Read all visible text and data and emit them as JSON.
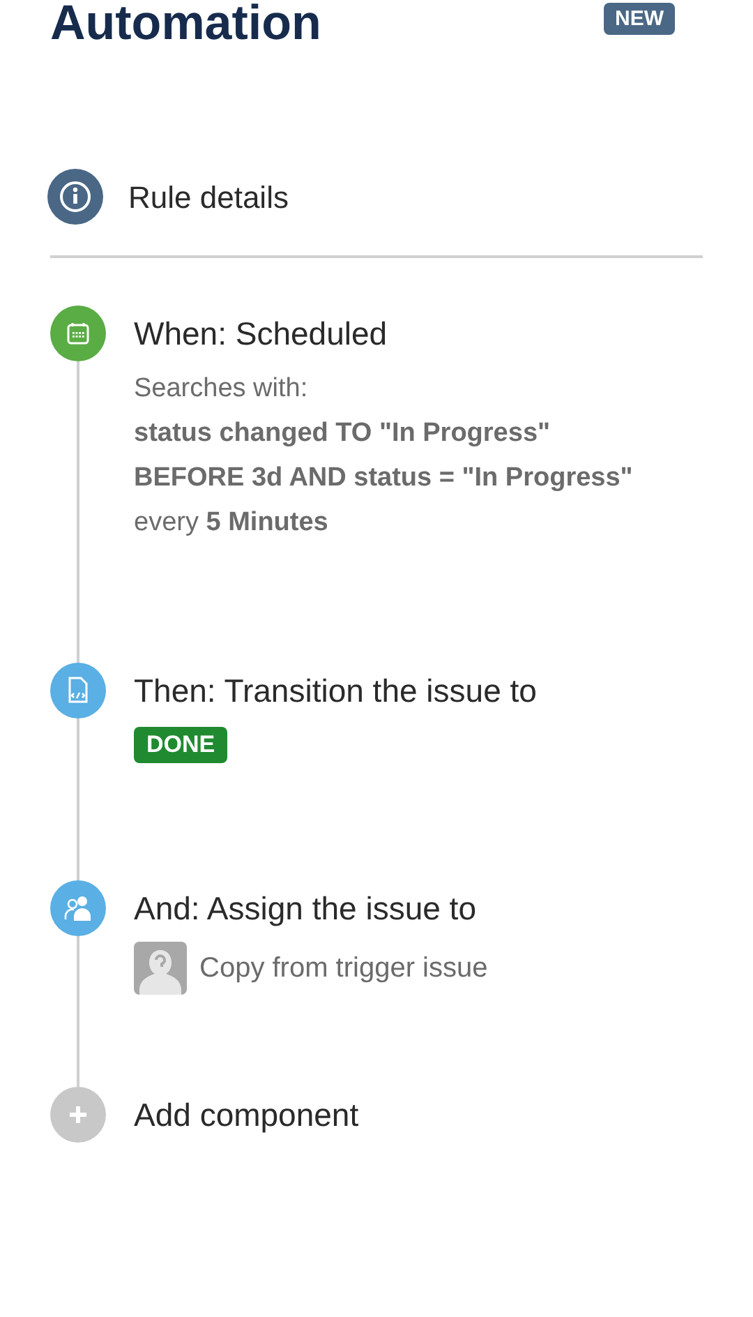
{
  "header": {
    "title": "Automation",
    "badge": "NEW"
  },
  "rule_details": {
    "label": "Rule details"
  },
  "steps": [
    {
      "kind": "trigger",
      "color": "#5aac44",
      "title": "When: Scheduled",
      "intro": "Searches with:",
      "query": "status changed TO \"In Progress\" BEFORE 3d AND status = \"In Progress\"",
      "schedule": "every **5 Minutes**"
    },
    {
      "kind": "transition",
      "color": "#5aafe4",
      "title": "Then: Transition the issue to",
      "status": "DONE"
    },
    {
      "kind": "assign",
      "color": "#5aafe4",
      "title": "And: Assign the issue to",
      "assignee": "Copy from trigger issue"
    },
    {
      "kind": "add",
      "color": "#c8c8c8",
      "title": "Add component"
    }
  ]
}
